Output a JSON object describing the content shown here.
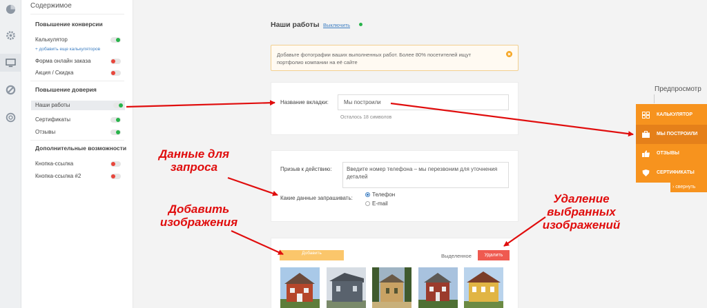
{
  "sidebar": {
    "title": "Содержимое",
    "sections": [
      {
        "title": "Повышение конверсии"
      },
      {
        "title": "Повышение доверия"
      },
      {
        "title": "Дополнительные возможности"
      }
    ],
    "items": [
      {
        "label": "Калькулятор",
        "on": true
      },
      {
        "label": "Форма онлайн заказа",
        "on": false
      },
      {
        "label": "Акция / Скидка",
        "on": false
      },
      {
        "label": "Наши работы",
        "on": true
      },
      {
        "label": "Сертификаты",
        "on": true
      },
      {
        "label": "Отзывы",
        "on": true
      },
      {
        "label": "Кнопка-ссылка",
        "on": false
      },
      {
        "label": "Кнопка-ссылка #2",
        "on": false
      }
    ],
    "add_calc_link": "+ добавить еще калькуляторов"
  },
  "main": {
    "title": "Наши работы",
    "toggle_link": "Выключить",
    "alert": "Добавьте фотографии ваших выполненных работ. Более 80% посетителей ищут портфолио компании на её сайте",
    "tab_name_label": "Название вкладки:",
    "tab_name_value": "Мы построили",
    "tab_name_hint": "Осталось 18 символов",
    "cta_label": "Призыв к действию:",
    "cta_value": "Введите номер телефона – мы перезвоним для уточнения деталей",
    "request_label": "Какие данные запрашивать:",
    "radio_options": [
      "Телефон",
      "E-mail"
    ],
    "radio_selected": "Телефон",
    "add_button": "Добавить",
    "selected_label": "Выделенное",
    "delete_button": "Удалить"
  },
  "preview": {
    "label": "Предпросмотр",
    "items": [
      {
        "label": "КАЛЬКУЛЯТОР",
        "icon": "calculator-icon"
      },
      {
        "label": "МЫ ПОСТРОИЛИ",
        "icon": "briefcase-icon"
      },
      {
        "label": "ОТЗЫВЫ",
        "icon": "thumbs-up-icon"
      },
      {
        "label": "СЕРТИФИКАТЫ",
        "icon": "shield-icon"
      }
    ],
    "active_index": 1,
    "collapse": "› свернуть"
  },
  "annotations": {
    "request_data": [
      "Данные для",
      "запроса"
    ],
    "add_images": [
      "Добавить",
      "изображения"
    ],
    "delete_images": [
      "Удаление",
      "выбранных",
      "изображений"
    ]
  },
  "colors": {
    "accent_orange": "#f7931e",
    "toggle_on": "#27b34a",
    "toggle_off": "#e8473c",
    "link_blue": "#3d7ec2",
    "annotation_red": "#e00d0d",
    "delete_red": "#ef5a50"
  }
}
